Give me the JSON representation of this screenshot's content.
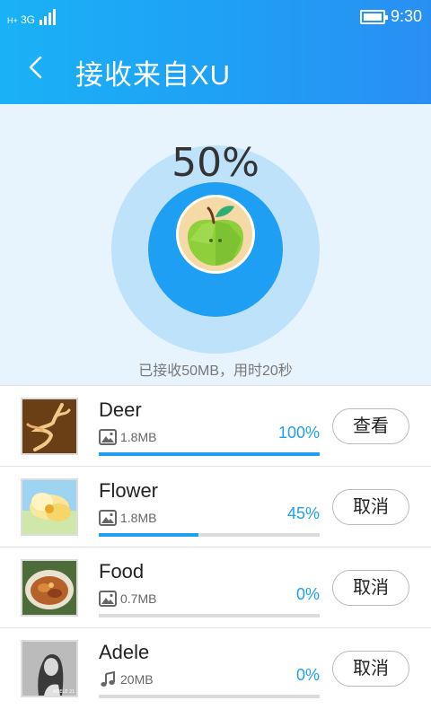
{
  "status_bar": {
    "network_h": "H+",
    "network_3g": "3G",
    "time": "9:30"
  },
  "header": {
    "back_icon": "chevron-left-icon",
    "title": "接收来自XU"
  },
  "progress": {
    "percent_text": "50%",
    "percent_value": 0.5,
    "received_text": "已接收50MB，用时20秒"
  },
  "colors": {
    "accent": "#1e9ff4",
    "header_start": "#1ab2f6",
    "header_end": "#2a8ff3",
    "panel_bg": "#e7f4fd",
    "outer_ring": "#bfe2fb"
  },
  "files": [
    {
      "name": "Deer",
      "type_icon": "image-icon",
      "size": "1.8MB",
      "percent": "100%",
      "progress": 1.0,
      "action": "查看"
    },
    {
      "name": "Flower",
      "type_icon": "image-icon",
      "size": "1.8MB",
      "percent": "45%",
      "progress": 0.45,
      "action": "取消"
    },
    {
      "name": "Food",
      "type_icon": "image-icon",
      "size": "0.7MB",
      "percent": "0%",
      "progress": 0.0,
      "action": "取消"
    },
    {
      "name": "Adele",
      "type_icon": "music-note-icon",
      "size": "20MB",
      "percent": "0%",
      "progress": 0.0,
      "action": "取消",
      "thumb_caption": "ADELE 21"
    }
  ]
}
